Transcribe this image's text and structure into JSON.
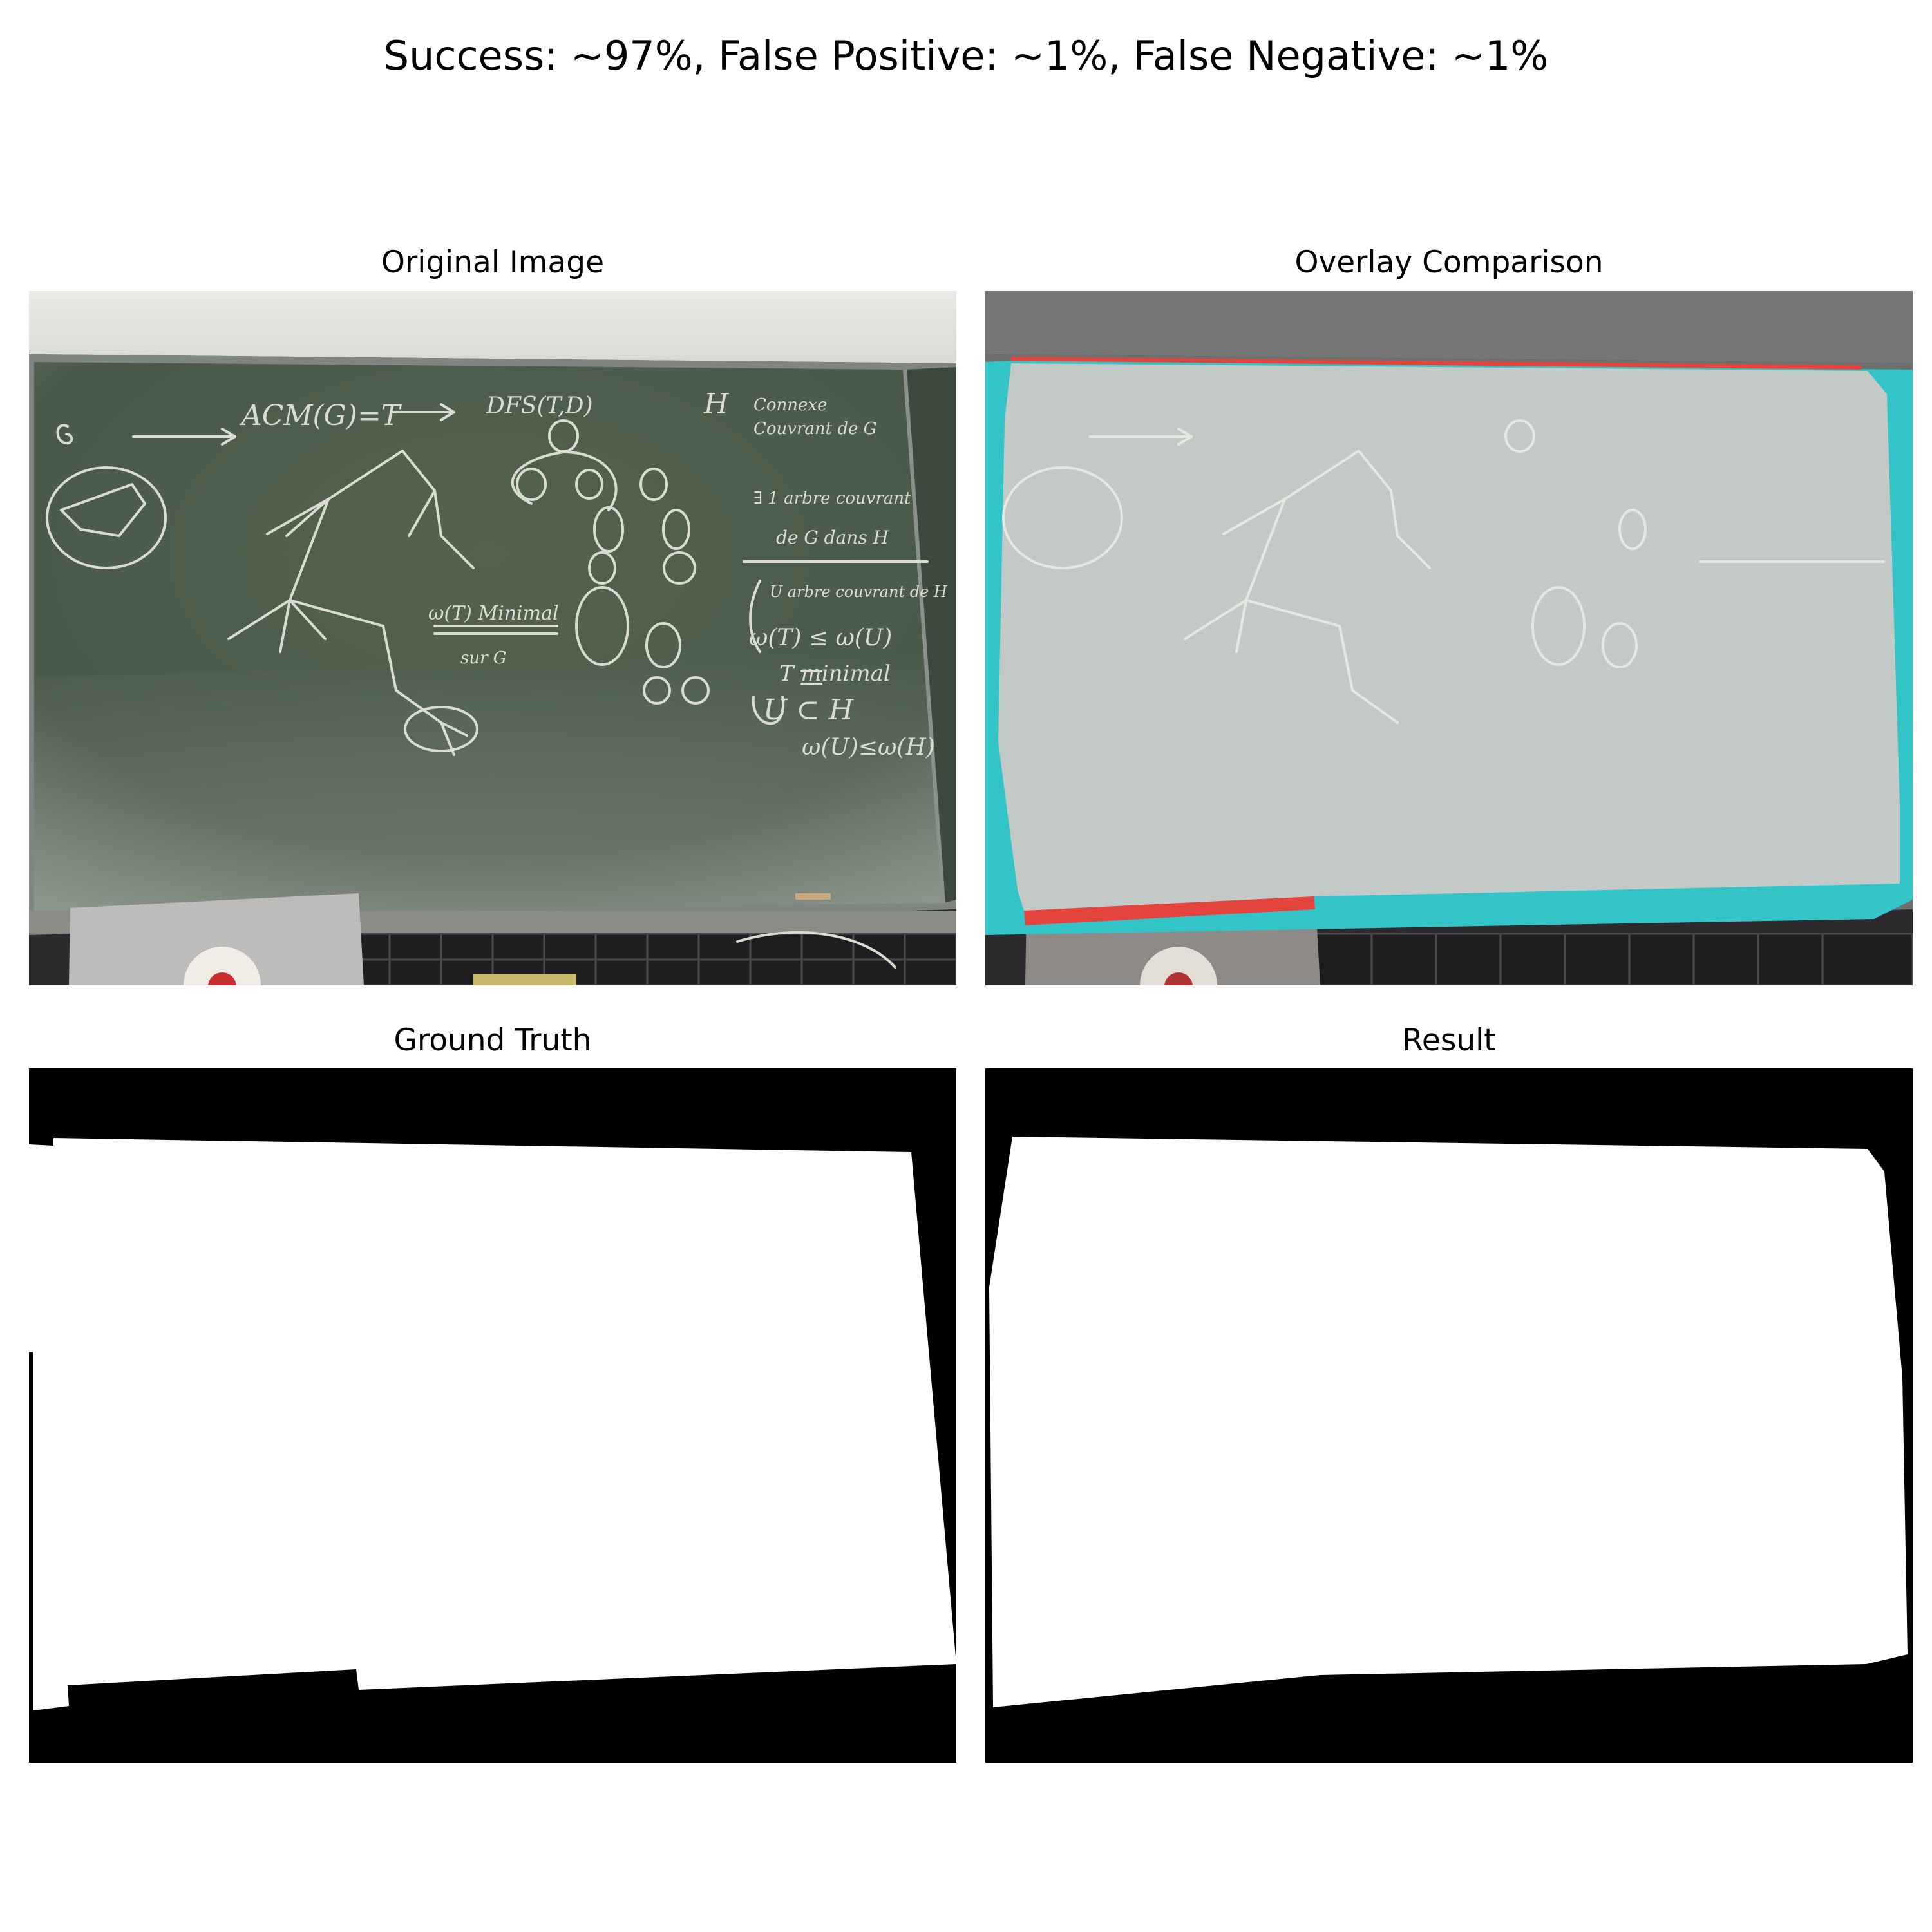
{
  "suptitle": "Success: ~97%, False Positive: ~1%, False Negative: ~1%",
  "panels": {
    "original": {
      "title": "Original Image"
    },
    "overlay": {
      "title": "Overlay Comparison"
    },
    "ground_truth": {
      "title": "Ground Truth"
    },
    "result": {
      "title": "Result"
    }
  },
  "chalk": {
    "acm": "ACM(G)=T",
    "dfs": "DFS(T,D)",
    "g": "G",
    "h": "H",
    "connexe": "Connexe",
    "couvrant": "Couvrant de G",
    "arbre": "∃ 1 arbre couvrant",
    "de_g_dans_h": "de G dans H",
    "u_arbre": "U arbre couvrant de H",
    "w_t_w_u": "ω(T) ≤ ω(U)",
    "t_minimal": "T minimal",
    "u_c_h": "U ⊂ H",
    "w_u_w_h": "ω(U)≤ω(H)",
    "w_t_minimal": "ω(T) Minimal",
    "sur_g": "sur G"
  },
  "colors": {
    "background": "#ffffff",
    "board": "#4b5a4c",
    "mask_fill": "#ffffff",
    "mask_bg": "#000000",
    "overlay_tint": "#c2c9c6",
    "false_positive": "#e5443e",
    "false_negative": "#33c4c8"
  }
}
